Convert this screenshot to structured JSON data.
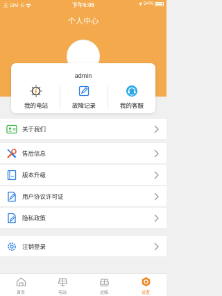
{
  "status_bar": {
    "carrier": "无 SIM 卡",
    "time": "下午5:05",
    "battery": "94%"
  },
  "header": {
    "title": "个人中心"
  },
  "profile": {
    "username": "admin"
  },
  "shortcuts": [
    {
      "label": "我的电站",
      "icon": "power-icon"
    },
    {
      "label": "故障记录",
      "icon": "edit-record-icon"
    },
    {
      "label": "我的客服",
      "icon": "headset-icon"
    }
  ],
  "menu": {
    "about": "关于我们",
    "after_sales": "售后信息",
    "upgrade": "版本升级",
    "license": "用户协议许可证",
    "privacy": "隐私政策",
    "logout": "注销登录"
  },
  "tabs": [
    {
      "label": "首页",
      "active": false
    },
    {
      "label": "电站",
      "active": false
    },
    {
      "label": "运维",
      "active": false
    },
    {
      "label": "设置",
      "active": true
    }
  ],
  "colors": {
    "primary": "#f3a94c",
    "accent": "#f08a24",
    "blue": "#2a7de1"
  }
}
